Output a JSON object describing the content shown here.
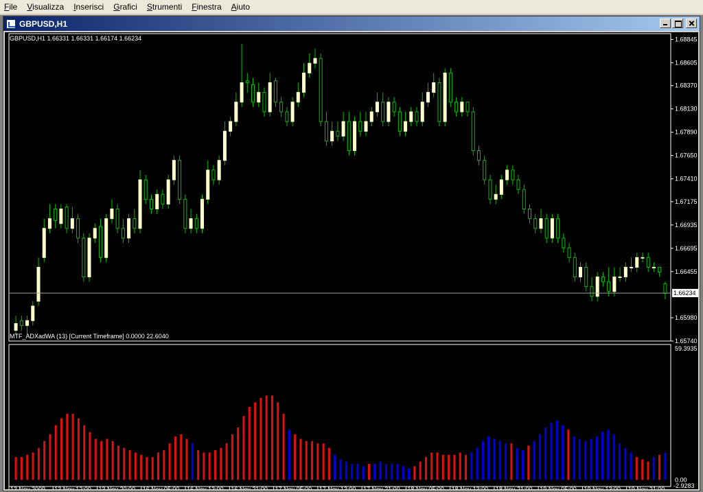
{
  "menubar": {
    "items": [
      "File",
      "Visualizza",
      "Inserisci",
      "Grafici",
      "Strumenti",
      "Finestra",
      "Aiuto"
    ]
  },
  "window": {
    "title": "GBPUSD,H1",
    "icon": "chart-window-icon"
  },
  "colors": {
    "background": "#000000",
    "candle_up_fill": "#ffffcc",
    "candle_wick": "#00c000",
    "axis_text": "#ffffff",
    "frame": "#ffffff",
    "current_price_line": "#a0a0a0",
    "hist_red": "#e01010",
    "hist_blue": "#0000e0"
  },
  "price_panel": {
    "header": "GBPUSD,H1  1.66331 1.66331 1.66174 1.66234",
    "ticks": [
      "1.68845",
      "1.68605",
      "1.68370",
      "1.68130",
      "1.67890",
      "1.67650",
      "1.67410",
      "1.67175",
      "1.66935",
      "1.66695",
      "1.66455",
      "1.65980",
      "1.65740"
    ],
    "current_price": "1.66234",
    "ylim": [
      1.6574,
      1.68905
    ]
  },
  "indicator_panel": {
    "header": "MTF_ADXadWA (13) [Current Timeframe] 0.0000 22.6040",
    "ticks": [
      "59.3935",
      "0.00"
    ],
    "bottom_value": "-2.9283",
    "ylim": [
      -2.9283,
      59.3935
    ]
  },
  "time_axis": {
    "labels": [
      "13 Nov 2009",
      "13 Nov 12:00",
      "13 Nov 20:00",
      "16 Nov 05:00",
      "16 Nov 13:00",
      "16 Nov 21:00",
      "17 Nov 05:00",
      "17 Nov 13:00",
      "17 Nov 21:00",
      "18 Nov 05:00",
      "18 Nov 13:00",
      "18 Nov 21:00",
      "19 Nov 05:00",
      "19 Nov 13:00",
      "19 Nov 21:00"
    ]
  },
  "chart_data": [
    {
      "type": "candlestick",
      "title": "GBPUSD,H1",
      "ylim": [
        1.6574,
        1.68905
      ],
      "close": [
        1.6592,
        1.659,
        1.6595,
        1.661,
        1.665,
        1.669,
        1.67,
        1.6698,
        1.671,
        1.669,
        1.67,
        1.668,
        1.664,
        1.668,
        1.669,
        1.666,
        1.67,
        1.671,
        1.669,
        1.668,
        1.67,
        1.669,
        1.674,
        1.672,
        1.671,
        1.6725,
        1.6715,
        1.674,
        1.676,
        1.672,
        1.669,
        1.67,
        1.669,
        1.672,
        1.675,
        1.674,
        1.676,
        1.679,
        1.68,
        1.682,
        1.684,
        1.684,
        1.682,
        1.683,
        1.681,
        1.684,
        1.682,
        1.681,
        1.68,
        1.682,
        1.683,
        1.685,
        1.686,
        1.6865,
        1.68,
        1.678,
        1.679,
        1.6785,
        1.68,
        1.677,
        1.68,
        1.679,
        1.68,
        1.681,
        1.682,
        1.68,
        1.682,
        1.681,
        1.679,
        1.68,
        1.681,
        1.68,
        1.682,
        1.683,
        1.684,
        1.68,
        1.685,
        1.682,
        1.681,
        1.682,
        1.681,
        1.677,
        1.676,
        1.674,
        1.672,
        1.6725,
        1.674,
        1.675,
        1.674,
        1.673,
        1.671,
        1.67,
        1.669,
        1.67,
        1.668,
        1.67,
        1.668,
        1.667,
        1.666,
        1.664,
        1.665,
        1.663,
        1.662,
        1.664,
        1.6635,
        1.6625,
        1.664,
        1.664,
        1.665,
        1.665,
        1.666,
        1.666,
        1.665,
        1.665,
        1.6645,
        1.6623
      ],
      "open": [
        1.6585,
        1.6595,
        1.659,
        1.6595,
        1.6615,
        1.666,
        1.669,
        1.671,
        1.6695,
        1.6712,
        1.669,
        1.67,
        1.668,
        1.664,
        1.668,
        1.6692,
        1.666,
        1.67,
        1.671,
        1.669,
        1.668,
        1.67,
        1.669,
        1.674,
        1.672,
        1.671,
        1.6725,
        1.6715,
        1.674,
        1.676,
        1.672,
        1.669,
        1.67,
        1.669,
        1.672,
        1.675,
        1.674,
        1.676,
        1.679,
        1.68,
        1.682,
        1.6842,
        1.6838,
        1.682,
        1.683,
        1.681,
        1.6842,
        1.682,
        1.681,
        1.68,
        1.682,
        1.683,
        1.685,
        1.686,
        1.6865,
        1.68,
        1.678,
        1.679,
        1.6785,
        1.68,
        1.677,
        1.68,
        1.679,
        1.68,
        1.681,
        1.682,
        1.68,
        1.682,
        1.681,
        1.679,
        1.68,
        1.681,
        1.68,
        1.682,
        1.683,
        1.684,
        1.68,
        1.685,
        1.682,
        1.681,
        1.682,
        1.681,
        1.677,
        1.676,
        1.674,
        1.672,
        1.6725,
        1.674,
        1.675,
        1.674,
        1.673,
        1.671,
        1.67,
        1.669,
        1.67,
        1.668,
        1.67,
        1.668,
        1.667,
        1.666,
        1.664,
        1.665,
        1.663,
        1.662,
        1.664,
        1.6635,
        1.6625,
        1.664,
        1.664,
        1.665,
        1.665,
        1.666,
        1.666,
        1.665,
        1.665,
        1.6633
      ],
      "high": [
        1.66,
        1.66,
        1.66,
        1.6615,
        1.666,
        1.67,
        1.6715,
        1.6715,
        1.6715,
        1.6715,
        1.6712,
        1.6705,
        1.6685,
        1.6685,
        1.6695,
        1.67,
        1.6705,
        1.672,
        1.6715,
        1.67,
        1.6705,
        1.671,
        1.675,
        1.6745,
        1.6725,
        1.673,
        1.673,
        1.6745,
        1.6765,
        1.6765,
        1.6725,
        1.671,
        1.6705,
        1.6725,
        1.676,
        1.6755,
        1.6765,
        1.68,
        1.6805,
        1.683,
        1.688,
        1.685,
        1.6845,
        1.684,
        1.6835,
        1.685,
        1.6845,
        1.6825,
        1.6815,
        1.6825,
        1.684,
        1.686,
        1.687,
        1.6875,
        1.687,
        1.681,
        1.68,
        1.68,
        1.681,
        1.681,
        1.6805,
        1.681,
        1.681,
        1.6815,
        1.683,
        1.683,
        1.6825,
        1.6825,
        1.6815,
        1.681,
        1.6815,
        1.6815,
        1.683,
        1.684,
        1.685,
        1.6845,
        1.6855,
        1.6855,
        1.6825,
        1.6825,
        1.682,
        1.6815,
        1.6775,
        1.6765,
        1.6745,
        1.6735,
        1.6745,
        1.6755,
        1.6755,
        1.6745,
        1.6735,
        1.6715,
        1.6705,
        1.671,
        1.6705,
        1.6705,
        1.6705,
        1.6685,
        1.6675,
        1.6665,
        1.6655,
        1.6655,
        1.664,
        1.6645,
        1.6645,
        1.665,
        1.665,
        1.665,
        1.6655,
        1.666,
        1.6665,
        1.6665,
        1.6665,
        1.6655,
        1.665,
        1.6635
      ],
      "low": [
        1.658,
        1.6585,
        1.658,
        1.659,
        1.661,
        1.6655,
        1.6685,
        1.669,
        1.669,
        1.6685,
        1.6685,
        1.6675,
        1.6635,
        1.6635,
        1.6675,
        1.6655,
        1.6655,
        1.6695,
        1.6685,
        1.6675,
        1.6675,
        1.6685,
        1.6685,
        1.6715,
        1.6705,
        1.6705,
        1.671,
        1.671,
        1.6735,
        1.6715,
        1.6685,
        1.6685,
        1.6685,
        1.6685,
        1.6715,
        1.6735,
        1.6735,
        1.6755,
        1.6785,
        1.6795,
        1.6815,
        1.683,
        1.6815,
        1.6815,
        1.6805,
        1.6805,
        1.6815,
        1.6805,
        1.6795,
        1.6795,
        1.6815,
        1.6825,
        1.6845,
        1.6855,
        1.6795,
        1.6775,
        1.6775,
        1.678,
        1.678,
        1.6765,
        1.6765,
        1.6785,
        1.6785,
        1.6795,
        1.6805,
        1.6795,
        1.6795,
        1.6805,
        1.6785,
        1.6785,
        1.6795,
        1.6795,
        1.6795,
        1.6815,
        1.6825,
        1.6795,
        1.6795,
        1.6815,
        1.6805,
        1.6805,
        1.6805,
        1.6765,
        1.6755,
        1.6735,
        1.6715,
        1.6715,
        1.672,
        1.6735,
        1.6735,
        1.6725,
        1.6705,
        1.6695,
        1.6685,
        1.6685,
        1.6675,
        1.6675,
        1.6675,
        1.6665,
        1.6655,
        1.6635,
        1.6635,
        1.6625,
        1.6615,
        1.6615,
        1.663,
        1.662,
        1.662,
        1.6635,
        1.6635,
        1.6645,
        1.6645,
        1.6655,
        1.6645,
        1.6645,
        1.664,
        1.6617
      ]
    },
    {
      "type": "bar",
      "title": "MTF_ADXadWA (13) [Current Timeframe] 0.0000 22.6040",
      "ylim": [
        -2.9283,
        59.3935
      ],
      "values": [
        10,
        10,
        11,
        12,
        14,
        17,
        20,
        24,
        27,
        29,
        29,
        27,
        24,
        21,
        18,
        17,
        18,
        17,
        15,
        14,
        13,
        12,
        11,
        10,
        10,
        12,
        13,
        16,
        19,
        20,
        18,
        16,
        13,
        12,
        12,
        13,
        14,
        16,
        20,
        23,
        28,
        32,
        34,
        36,
        37,
        37,
        34,
        29,
        22,
        20,
        18,
        17,
        17,
        16,
        16,
        14,
        11,
        9,
        8,
        7,
        7,
        6,
        7,
        7,
        8,
        7,
        7,
        7,
        6,
        5,
        6,
        8,
        10,
        12,
        12,
        11,
        11,
        11,
        12,
        11,
        12,
        14,
        17,
        19,
        18,
        17,
        16,
        16,
        14,
        13,
        15,
        17,
        20,
        23,
        25,
        26,
        24,
        22,
        19,
        18,
        17,
        18,
        19,
        21,
        22,
        20,
        16,
        14,
        12,
        10,
        9,
        8,
        10,
        11,
        12
      ],
      "colors": [
        "red",
        "red",
        "red",
        "red",
        "red",
        "red",
        "red",
        "red",
        "red",
        "red",
        "red",
        "red",
        "red",
        "red",
        "red",
        "red",
        "red",
        "red",
        "red",
        "red",
        "red",
        "red",
        "red",
        "red",
        "red",
        "red",
        "red",
        "red",
        "red",
        "red",
        "red",
        "blue",
        "red",
        "red",
        "red",
        "red",
        "red",
        "red",
        "red",
        "red",
        "red",
        "red",
        "red",
        "red",
        "red",
        "red",
        "red",
        "red",
        "blue",
        "red",
        "red",
        "red",
        "red",
        "red",
        "red",
        "red",
        "blue",
        "blue",
        "blue",
        "blue",
        "blue",
        "blue",
        "red",
        "blue",
        "blue",
        "blue",
        "blue",
        "blue",
        "blue",
        "blue",
        "red",
        "red",
        "red",
        "red",
        "red",
        "red",
        "red",
        "red",
        "red",
        "red",
        "blue",
        "blue",
        "blue",
        "blue",
        "blue",
        "blue",
        "blue",
        "red",
        "blue",
        "blue",
        "red",
        "blue",
        "blue",
        "blue",
        "blue",
        "blue",
        "blue",
        "red",
        "blue",
        "blue",
        "blue",
        "blue",
        "blue",
        "blue",
        "blue",
        "blue",
        "blue",
        "blue",
        "blue",
        "red",
        "red",
        "red",
        "blue",
        "red",
        "blue"
      ]
    }
  ]
}
